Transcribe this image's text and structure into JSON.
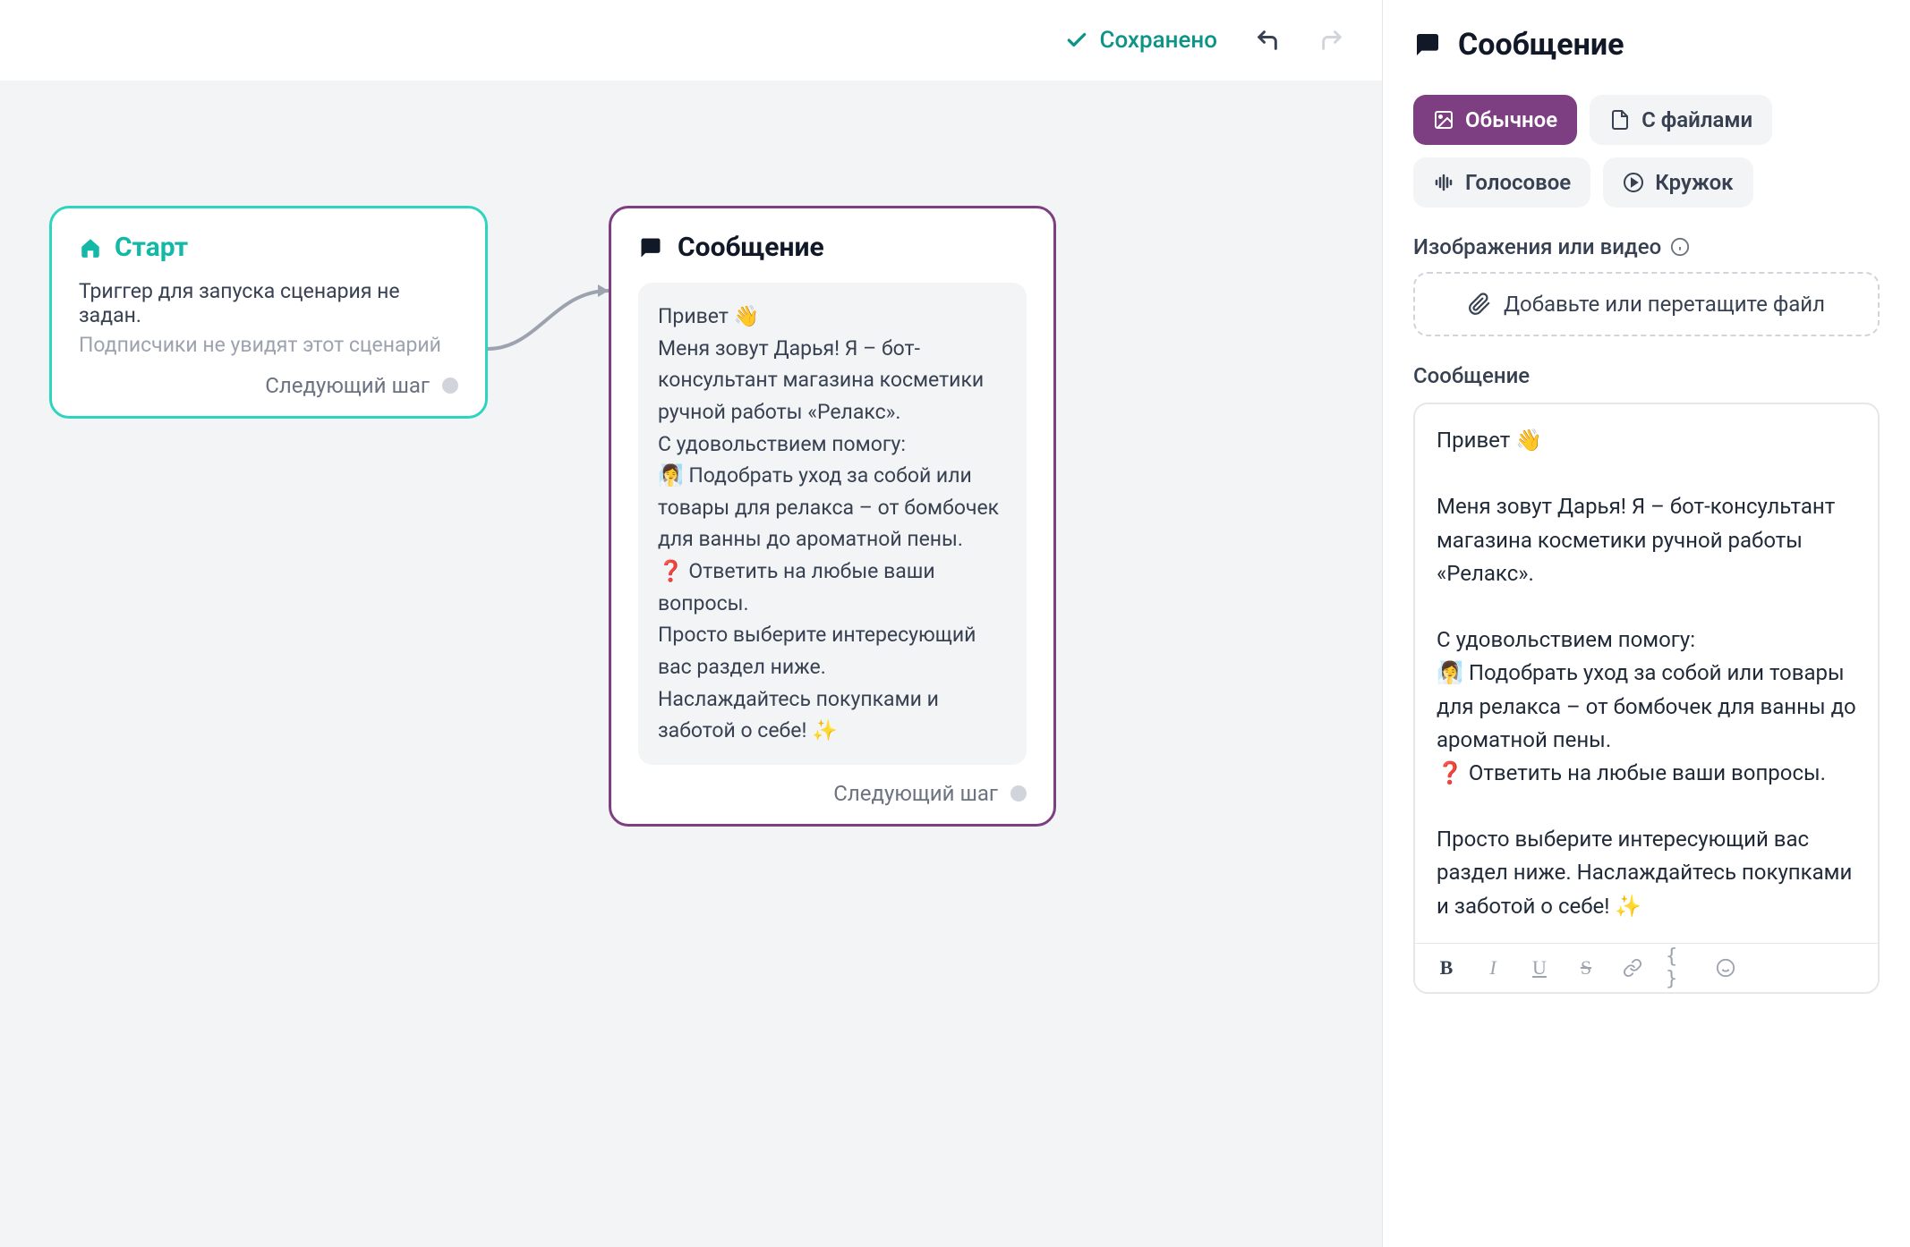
{
  "topbar": {
    "saved_label": "Сохранено"
  },
  "canvas": {
    "start_node": {
      "title": "Старт",
      "desc": "Триггер для запуска сценария не задан.",
      "hint": "Подписчики не увидят этот сценарий",
      "next": "Следующий шаг"
    },
    "message_node": {
      "title": "Сообщение",
      "body": "Привет 👋\nМеня зовут Дарья! Я – бот-консультант магазина косметики ручной работы «Релакс».\nС удовольствием помогу:\n🧖‍♀️ Подобрать уход за собой или товары для релакса – от бомбочек для ванны до ароматной пены.\n❓ Ответить на любые ваши вопросы.\nПросто выберите интересующий вас раздел ниже.\nНаслаждайтесь покупками и заботой о себе! ✨",
      "next": "Следующий шаг"
    }
  },
  "sidepanel": {
    "title": "Сообщение",
    "tabs": {
      "regular": "Обычное",
      "files": "С файлами",
      "voice": "Голосовое",
      "circle": "Кружок"
    },
    "media_label": "Изображения или видео",
    "dropzone": "Добавьте или перетащите файл",
    "message_label": "Сообщение",
    "editor_text": "Привет 👋\n\nМеня зовут Дарья! Я – бот-консультант магазина косметики ручной работы «Релакс».\n\nС удовольствием помогу:\n🧖‍♀️ Подобрать уход за собой или товары для релакса – от бомбочек для ванны до ароматной пены.\n❓ Ответить на любые ваши вопросы.\n\nПросто выберите интересующий вас раздел ниже. Наслаждайтесь покупками и заботой о себе! ✨",
    "toolbar": {
      "bold": "B",
      "italic": "I",
      "underline": "U",
      "strike": "S",
      "link": "🔗",
      "braces": "{ }",
      "emoji": "☺"
    }
  },
  "colors": {
    "teal": "#14b8a6",
    "purple": "#7e3e82",
    "canvas_bg": "#f3f4f6"
  }
}
